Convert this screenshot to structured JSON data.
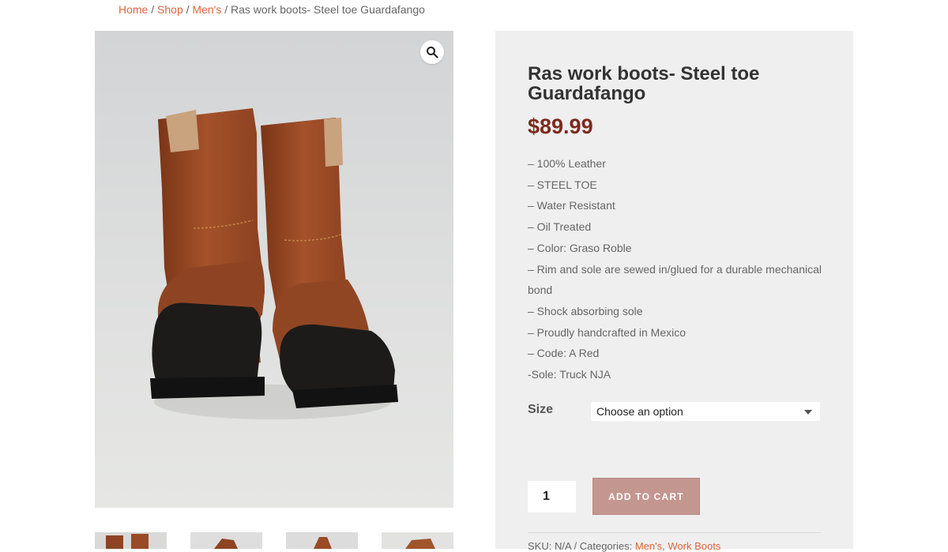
{
  "breadcrumb": {
    "home": "Home",
    "shop": "Shop",
    "category": "Men's",
    "current": "Ras work boots- Steel toe Guardafango",
    "separator": " / "
  },
  "gallery": {
    "zoom_icon": "magnifier-icon",
    "main_image_alt": "Brown leather work boots with black steel toe caps",
    "thumbnail_count": 4
  },
  "product": {
    "title": "Ras work boots- Steel toe Guardafango",
    "price": "$89.99",
    "description": [
      "– 100% Leather",
      "– STEEL TOE",
      "– Water Resistant",
      "– Oil Treated",
      "– Color: Graso Roble",
      "– Rim and sole are sewed in/glued for a durable mechanical bond",
      "– Shock absorbing sole",
      "– Proudly handcrafted in Mexico",
      "– Code: A Red",
      "-Sole: Truck NJA"
    ]
  },
  "variations": {
    "size_label": "Size",
    "size_selected": "Choose an option"
  },
  "cart": {
    "quantity": "1",
    "add_to_cart_label": "ADD TO CART"
  },
  "meta": {
    "sku_text": "SKU: N/A / Categories: ",
    "category_1": "Men's",
    "category_sep": ", ",
    "category_2": "Work Boots"
  },
  "colors": {
    "accent_link": "#e0643a",
    "price": "#7c2a1e",
    "button": "#c49690",
    "summary_bg": "#efefef"
  }
}
